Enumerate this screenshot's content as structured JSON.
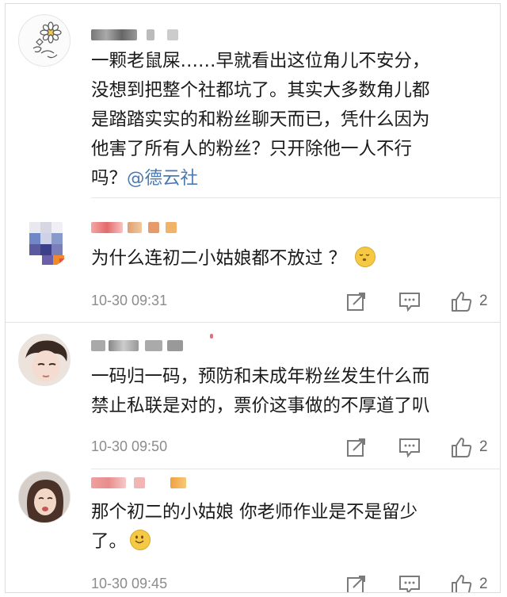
{
  "comments": [
    {
      "username": "",
      "text_lines": [
        "一颗老鼠屎……早就看出这位角儿不安分，",
        "没想到把整个社都坑了。其实大多数角儿都",
        "是踏踏实实的和粉丝聊天而已，凭什么因为",
        "他害了所有人的粉丝？只开除他一人不行"
      ],
      "last_line_prefix": "吗？",
      "mention": "@德云社"
    },
    {
      "username": "",
      "text": "为什么连初二小姑娘都不放过 ？",
      "emoji": "sleepy-face",
      "time": "10-30 09:31",
      "likes": "2"
    },
    {
      "username": "",
      "text_lines": [
        "一码归一码，预防和未成年粉丝发生什么而",
        "禁止私联是对的，票价这事做的不厚道了叭"
      ],
      "time": "10-30 09:50",
      "likes": "2"
    },
    {
      "username": "",
      "text_lines": [
        "那个初二的小姑娘 你老师作业是不是留少"
      ],
      "last_line_prefix": "了。",
      "emoji": "smiley-face",
      "time": "10-30 09:45",
      "likes": "2"
    }
  ],
  "colors": {
    "mention": "#4a7ab5",
    "time": "#8c8c8c",
    "icon": "#7a7a7a"
  }
}
